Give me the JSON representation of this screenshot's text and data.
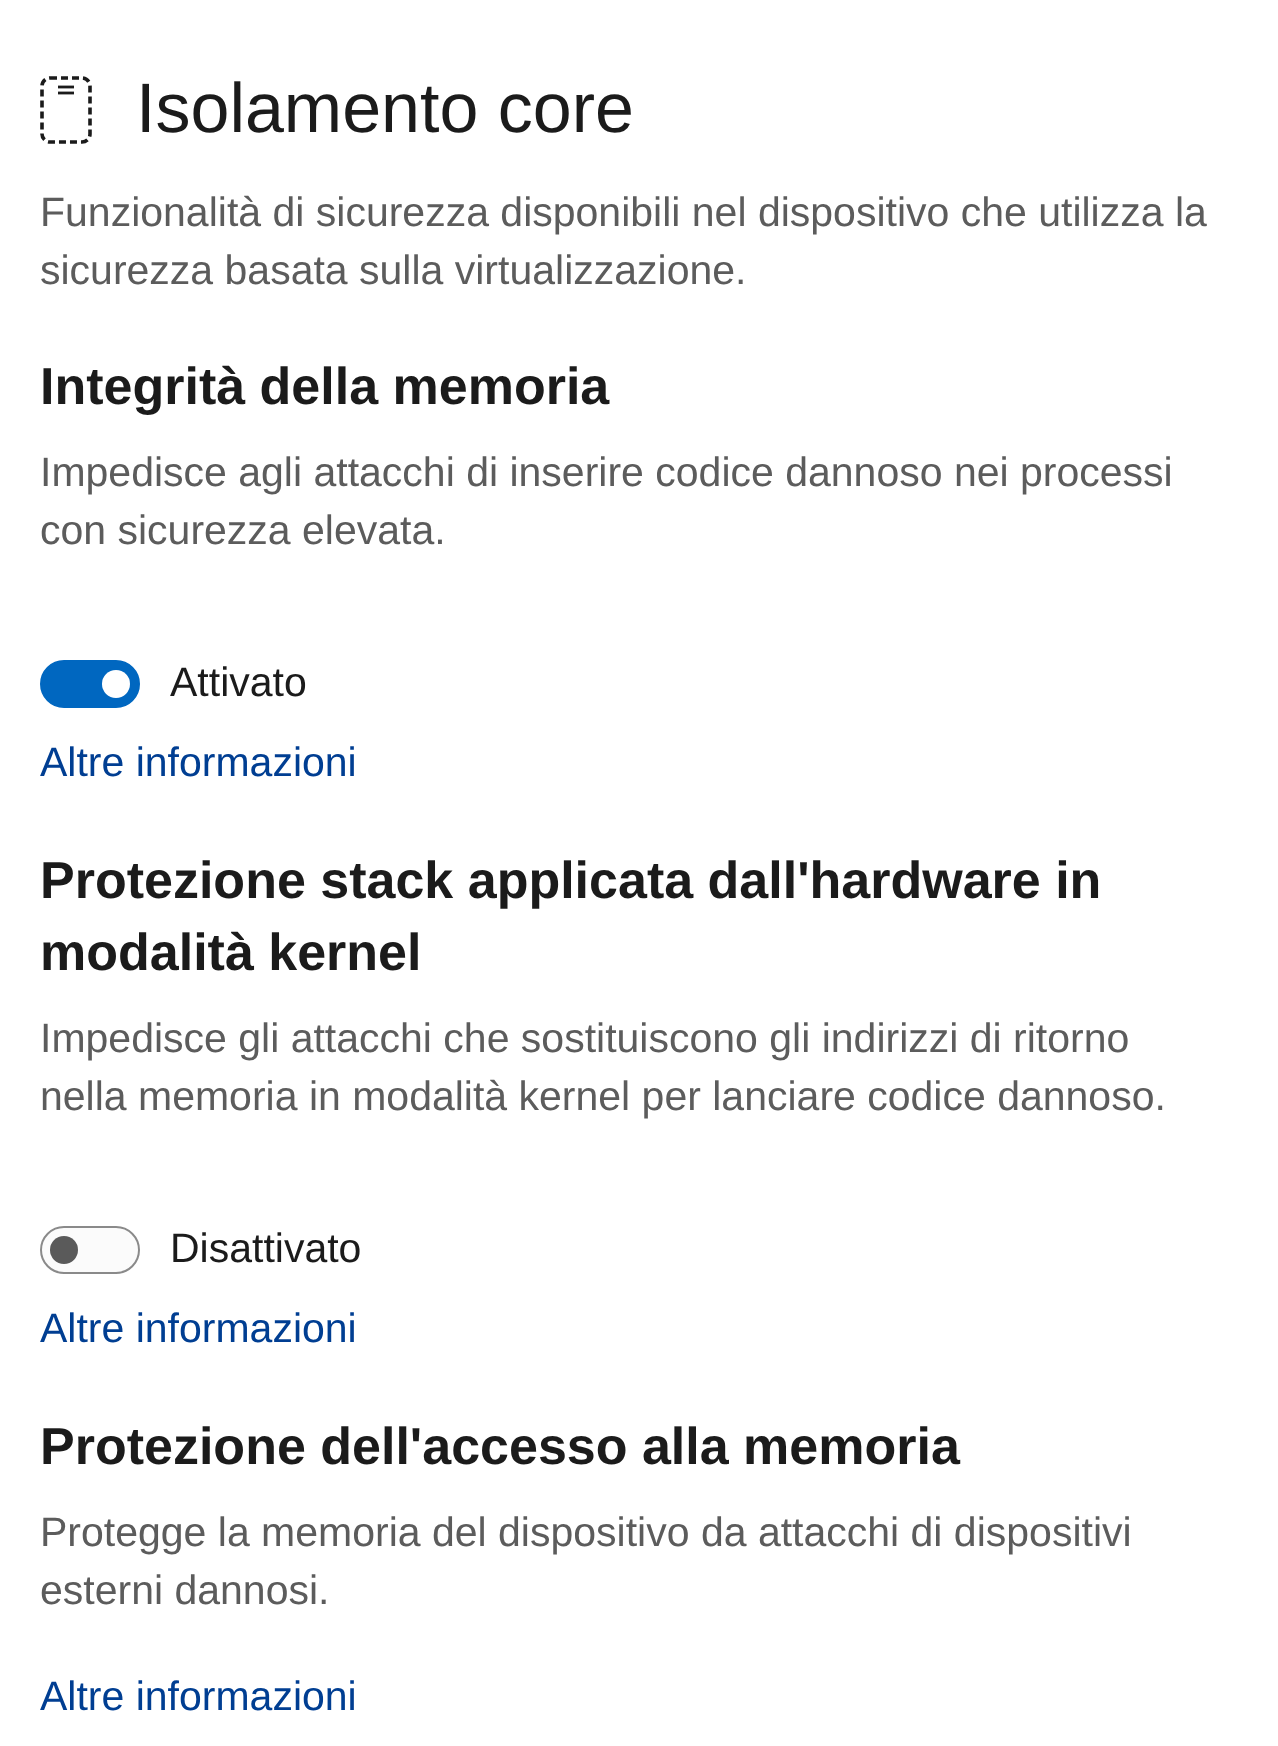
{
  "header": {
    "title": "Isolamento core",
    "description": "Funzionalità di sicurezza disponibili nel dispositivo che utilizza la\nsicurezza basata sulla virtualizzazione."
  },
  "sections": [
    {
      "title": "Integrità della memoria",
      "description": "Impedisce agli attacchi di inserire codice dannoso nei processi\ncon sicurezza elevata.",
      "toggle": {
        "on": true,
        "label": "Attivato"
      },
      "link": "Altre informazioni"
    },
    {
      "title": "Protezione stack applicata dall'hardware in modalità kernel",
      "description": "Impedisce gli attacchi che sostituiscono gli indirizzi di ritorno\nnella memoria in modalità kernel per lanciare codice dannoso.",
      "toggle": {
        "on": false,
        "label": "Disattivato"
      },
      "link": "Altre informazioni"
    },
    {
      "title": "Protezione dell'accesso alla memoria",
      "description": "Protegge la memoria del dispositivo da attacchi di dispositivi\nesterni dannosi.",
      "link": "Altre informazioni"
    }
  ]
}
